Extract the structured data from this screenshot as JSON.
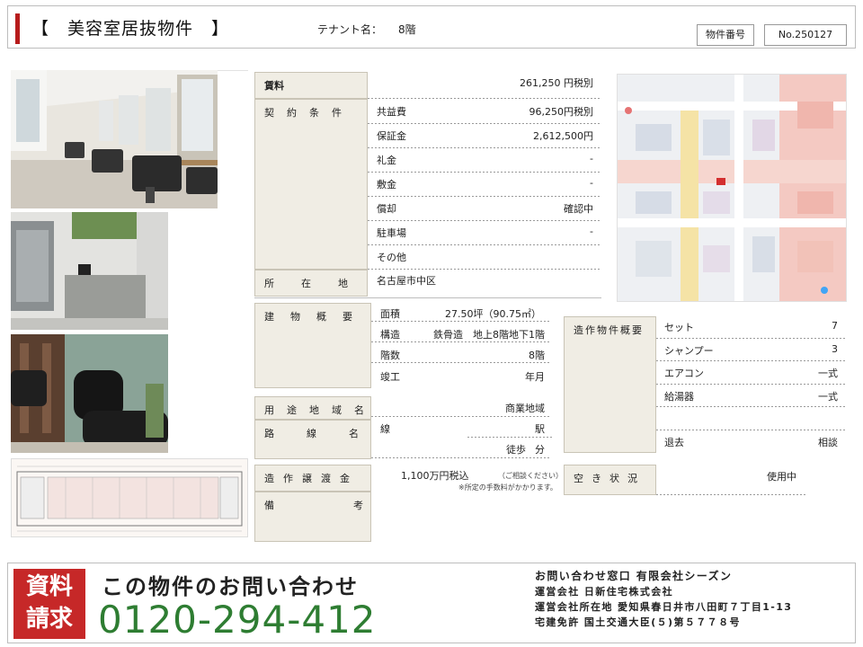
{
  "header": {
    "title": "【　美容室居抜物件　】",
    "tenant_label": "テナント名：",
    "tenant_value": "8階",
    "property_no_label": "物件番号",
    "property_no_value": "No.250127"
  },
  "conditions": {
    "rent_label": "賃料",
    "rent_value": "261,250 円税別",
    "contract_label": "契約条件",
    "items": [
      {
        "key": "共益費",
        "value": "96,250円税別"
      },
      {
        "key": "保証金",
        "value": "2,612,500円"
      },
      {
        "key": "礼金",
        "value": "-"
      },
      {
        "key": "敷金",
        "value": "-"
      },
      {
        "key": "償却",
        "value": "確認中"
      },
      {
        "key": "駐車場",
        "value": "-"
      },
      {
        "key": "その他",
        "value": ""
      }
    ],
    "location_label": "所在地",
    "location_value": "名古屋市中区"
  },
  "building": {
    "label": "建物概要",
    "area_key": "面積",
    "area_value": "27.50坪（90.75㎡）",
    "structure_key": "構造",
    "structure_value": "鉄骨造　地上8階地下1階",
    "floor_key": "階数",
    "floor_value": "8階",
    "built_key": "竣工",
    "built_value": "年月"
  },
  "zoning": {
    "label": "用途地域名",
    "value": "商業地域"
  },
  "route": {
    "label": "路線名",
    "line_key": "線",
    "station_key": "駅",
    "walk_key": "徒歩",
    "walk_unit": "分"
  },
  "transfer": {
    "label": "造作譲渡金",
    "value": "1,100万円税込",
    "consult": "（ご相談ください）",
    "note": "※所定の手数料がかかります。"
  },
  "remarks": {
    "label": "備考"
  },
  "fixtures": {
    "label": "造作物件概要",
    "items": [
      {
        "key": "セット",
        "value": "7"
      },
      {
        "key": "シャンプー",
        "value": "3"
      },
      {
        "key": "エアコン",
        "value": "一式"
      },
      {
        "key": "給湯器",
        "value": "一式"
      },
      {
        "key": "",
        "value": ""
      },
      {
        "key": "退去",
        "value": "相談"
      }
    ]
  },
  "vacancy": {
    "label": "空き状況",
    "value": "使用中"
  },
  "footer": {
    "badge_line1": "資料",
    "badge_line2": "請求",
    "inquiry": "この物件のお問い合わせ",
    "phone": "0120-294-412",
    "line1": "お問い合わせ窓口 有限会社シーズン",
    "line2": "運営会社 日新住宅株式会社",
    "line3": "運営会社所在地 愛知県春日井市八田町７丁目1-13",
    "line4": "宅建免許 国土交通大臣(５)第５７７８号"
  },
  "colors": {
    "accent": "#b71c1c",
    "label_bg": "#f0ede4",
    "phone": "#2e7d32",
    "badge": "#c62828"
  }
}
